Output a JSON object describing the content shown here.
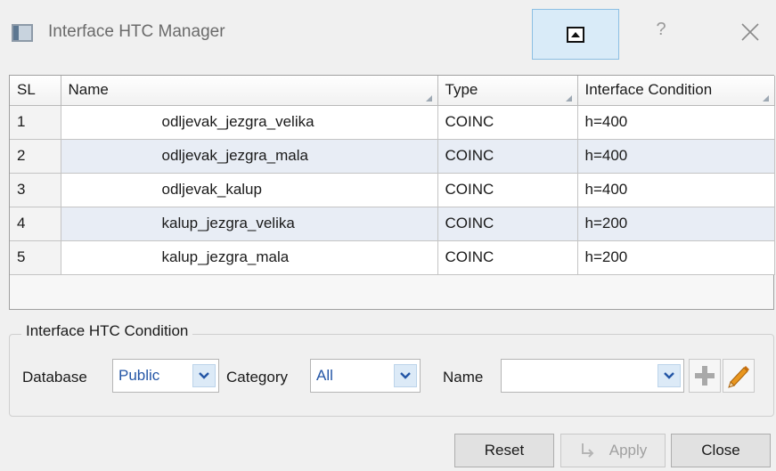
{
  "window": {
    "title": "Interface HTC Manager",
    "help_glyph": "?",
    "icons": [
      "app-icon",
      "collapse-panel-icon",
      "help-icon",
      "close-icon"
    ]
  },
  "grid": {
    "columns": [
      "SL",
      "Name",
      "Type",
      "Interface Condition"
    ],
    "rows": [
      {
        "sl": "1",
        "name": "odljevak_jezgra_velika",
        "type": "COINC",
        "condition": "h=400"
      },
      {
        "sl": "2",
        "name": "odljevak_jezgra_mala",
        "type": "COINC",
        "condition": "h=400"
      },
      {
        "sl": "3",
        "name": "odljevak_kalup",
        "type": "COINC",
        "condition": "h=400"
      },
      {
        "sl": "4",
        "name": "kalup_jezgra_velika",
        "type": "COINC",
        "condition": "h=200"
      },
      {
        "sl": "5",
        "name": "kalup_jezgra_mala",
        "type": "COINC",
        "condition": "h=200"
      }
    ],
    "row_colors": {
      "odd": "#ffffff",
      "even": "#e8edf5"
    }
  },
  "condition_group": {
    "title": "Interface HTC Condition",
    "database_label": "Database",
    "database_value": "Public",
    "category_label": "Category",
    "category_value": "All",
    "name_label": "Name",
    "name_value": "",
    "icons": [
      "add-icon",
      "edit-pencil-icon",
      "chevron-down-icon"
    ]
  },
  "buttons": {
    "reset": "Reset",
    "apply": "Apply",
    "close": "Close"
  },
  "colors": {
    "accent_blue": "#2456a6",
    "pin_button_bg": "#d9ebf8",
    "pencil": "#e8961e"
  }
}
